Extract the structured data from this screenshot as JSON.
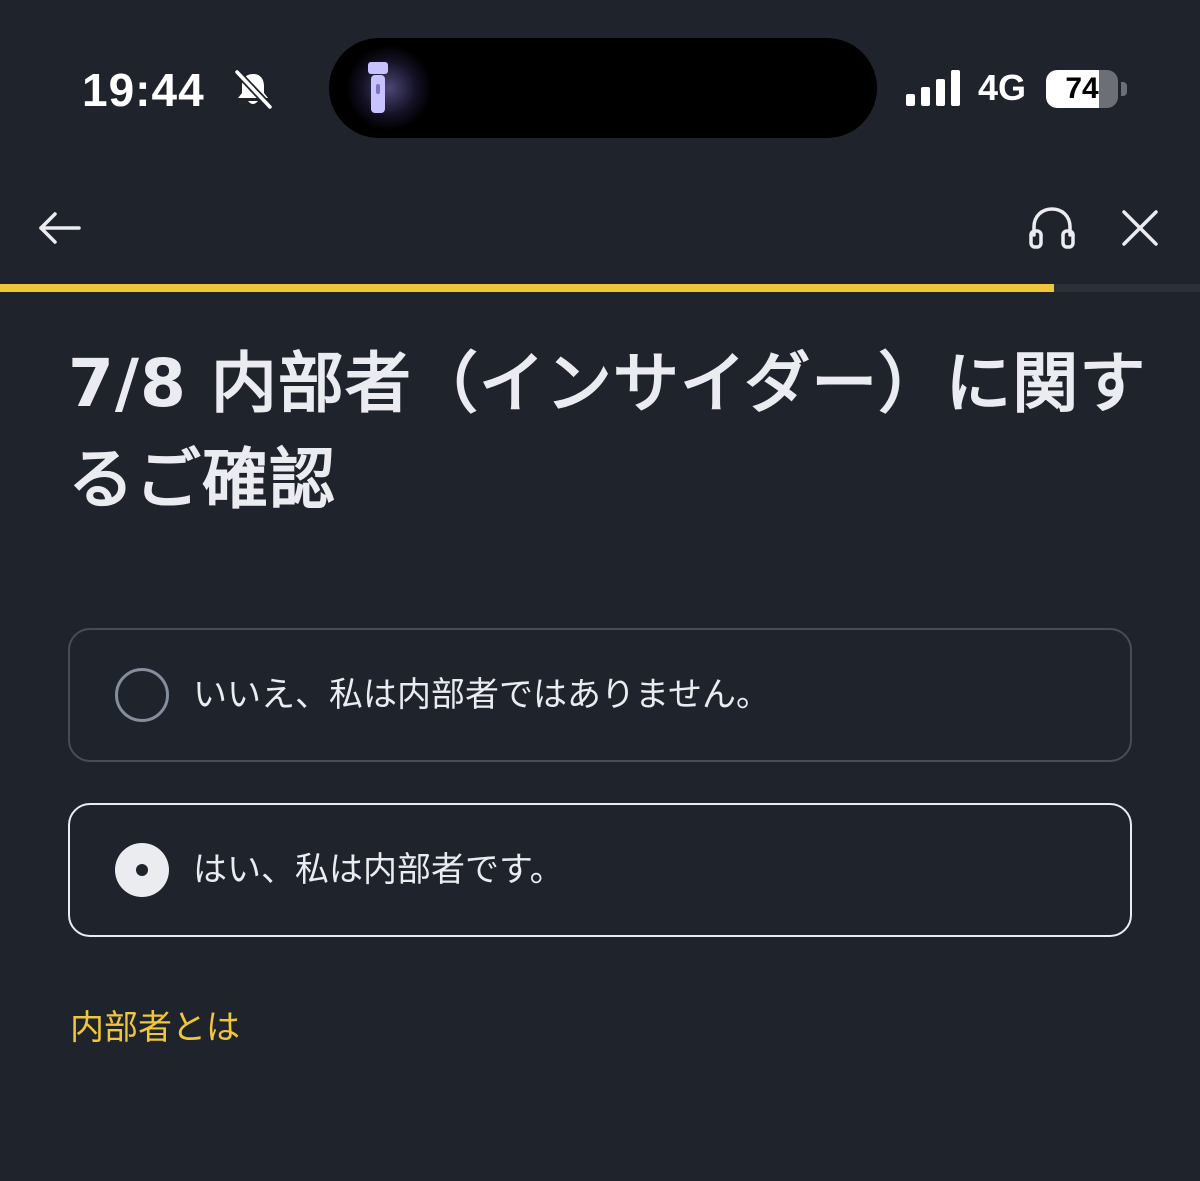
{
  "status_bar": {
    "time": "19:44",
    "network": "4G",
    "battery_level": "74",
    "battery_fraction": 0.74,
    "icons": [
      "bell-slash-icon",
      "flashlight-icon",
      "signal-icon",
      "battery-icon"
    ]
  },
  "nav": {
    "back_icon": "arrow-left-icon",
    "support_icon": "headset-icon",
    "close_icon": "close-icon"
  },
  "progress": {
    "fraction": 0.878
  },
  "page": {
    "title": "7/8 内部者（インサイダー）に関するご確認"
  },
  "options": [
    {
      "label": "いいえ、私は内部者ではありません。",
      "selected": false
    },
    {
      "label": "はい、私は内部者です。",
      "selected": true
    }
  ],
  "link": {
    "label": "内部者とは"
  },
  "colors": {
    "background": "#1f232b",
    "text": "#eaecef",
    "accent": "#f0c63a",
    "border": "#474d57",
    "progress_track": "#2b3139"
  }
}
